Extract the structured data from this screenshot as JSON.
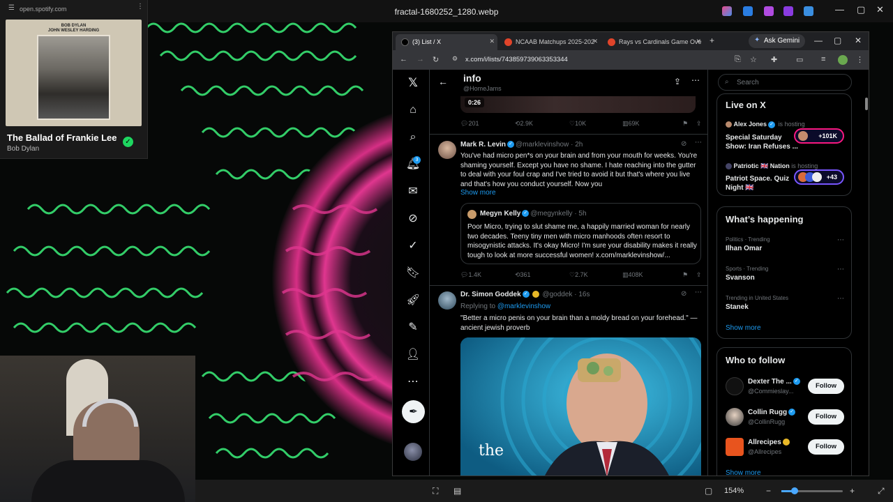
{
  "viewer": {
    "title": "fractal-1680252_1280.webp",
    "zoom": "154%"
  },
  "spotify": {
    "url": "open.spotify.com",
    "album_cover_text_line1": "BOB DYLAN",
    "album_cover_text_line2": "JOHN WESLEY HARDING",
    "track_title": "The Ballad of Frankie Lee",
    "artist": "Bob Dylan"
  },
  "browser": {
    "tabs": [
      {
        "label": "(3) List / X",
        "active": true
      },
      {
        "label": "NCAAB Matchups 2025-202",
        "active": false
      },
      {
        "label": "Rays vs Cardinals Game Ove",
        "active": false
      }
    ],
    "gemini_label": "Ask Gemini",
    "url": "x.com/i/lists/743859739063353344"
  },
  "timeline": {
    "header_title": "info",
    "header_subtitle": "@HomeJams",
    "video_time": "0:26",
    "first_actions": {
      "replies": "201",
      "reposts": "2.9K",
      "likes": "10K",
      "views": "69K"
    },
    "tweet1": {
      "name": "Mark R. Levin",
      "handle": "@marklevinshow",
      "time": "· 2h",
      "text": "You've had micro pen*s on your brain and from your mouth for weeks. You're shaming yourself.  Except you have no shame. I hate reaching into the gutter to deal with your foul crap and I've tried to avoid it but that's where you live and that's how you conduct yourself.  Now you",
      "show_more": "Show more",
      "quote": {
        "name": "Megyn Kelly",
        "handle": "@megynkelly",
        "time": "· 5h",
        "text": "Poor Micro, trying to slut shame me, a happily married woman for nearly two decades. Teeny tiny men with micro manhoods often resort to misogynistic attacks. It's okay Micro! I'm sure your disability makes it really tough to look at more successful women! x.com/marklevinshow/..."
      },
      "actions": {
        "replies": "1.4K",
        "reposts": "361",
        "likes": "2.7K",
        "views": "408K"
      }
    },
    "tweet2": {
      "name": "Dr. Simon Goddek",
      "handle": "@goddek",
      "time": "· 16s",
      "replying_label": "Replying to",
      "replying_to": "@marklevinshow",
      "text": "\"Better a micro penis on your brain than a moldy bread on your forehead.\" — ancient jewish proverb",
      "media_text": "the"
    }
  },
  "sidebar": {
    "search_placeholder": "Search",
    "live": {
      "title": "Live on X",
      "spaces": [
        {
          "host": "Alex Jones",
          "status": "is hosting",
          "title": "Special Saturday Show: Iran Refuses ...",
          "count": "+101K"
        },
        {
          "host": "Patriotic 🇬🇧 Nation",
          "status": "is hosting",
          "title": "Patriot Space. Quiz Night 🇬🇧",
          "count": "+43"
        }
      ]
    },
    "happening": {
      "title": "What’s happening",
      "trends": [
        {
          "category": "Politics · Trending",
          "name": "Ilhan Omar"
        },
        {
          "category": "Sports · Trending",
          "name": "Svanson"
        },
        {
          "category": "Trending in United States",
          "name": "Stanek"
        }
      ],
      "show_more": "Show more"
    },
    "who_to_follow": {
      "title": "Who to follow",
      "accounts": [
        {
          "name": "Dexter The ...",
          "handle": "@Commieslay...",
          "button": "Follow"
        },
        {
          "name": "Collin Rugg",
          "handle": "@CollinRugg",
          "button": "Follow"
        },
        {
          "name": "Allrecipes",
          "handle": "@Allrecipes",
          "button": "Follow"
        }
      ],
      "show_more": "Show more"
    }
  },
  "colors": {
    "x_blue": "#1d9bf0",
    "fractal_pink": "#e0368f",
    "fractal_green": "#3bf07a",
    "spotify_green": "#1ed760"
  }
}
